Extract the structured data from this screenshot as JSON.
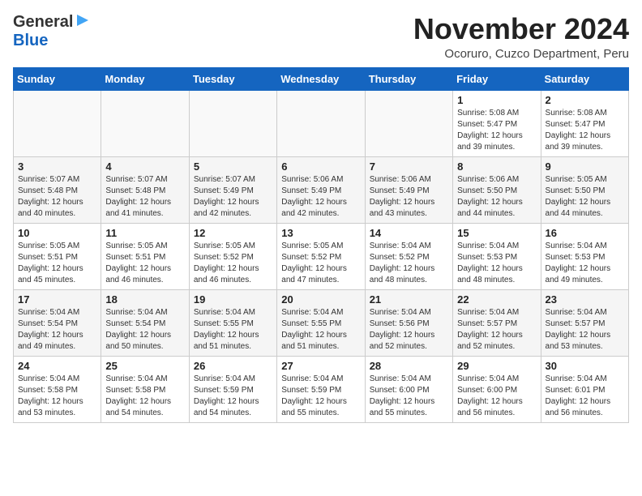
{
  "header": {
    "logo_line1": "General",
    "logo_line2": "Blue",
    "month": "November 2024",
    "location": "Ocoruro, Cuzco Department, Peru"
  },
  "weekdays": [
    "Sunday",
    "Monday",
    "Tuesday",
    "Wednesday",
    "Thursday",
    "Friday",
    "Saturday"
  ],
  "weeks": [
    [
      {
        "day": "",
        "info": ""
      },
      {
        "day": "",
        "info": ""
      },
      {
        "day": "",
        "info": ""
      },
      {
        "day": "",
        "info": ""
      },
      {
        "day": "",
        "info": ""
      },
      {
        "day": "1",
        "info": "Sunrise: 5:08 AM\nSunset: 5:47 PM\nDaylight: 12 hours\nand 39 minutes."
      },
      {
        "day": "2",
        "info": "Sunrise: 5:08 AM\nSunset: 5:47 PM\nDaylight: 12 hours\nand 39 minutes."
      }
    ],
    [
      {
        "day": "3",
        "info": "Sunrise: 5:07 AM\nSunset: 5:48 PM\nDaylight: 12 hours\nand 40 minutes."
      },
      {
        "day": "4",
        "info": "Sunrise: 5:07 AM\nSunset: 5:48 PM\nDaylight: 12 hours\nand 41 minutes."
      },
      {
        "day": "5",
        "info": "Sunrise: 5:07 AM\nSunset: 5:49 PM\nDaylight: 12 hours\nand 42 minutes."
      },
      {
        "day": "6",
        "info": "Sunrise: 5:06 AM\nSunset: 5:49 PM\nDaylight: 12 hours\nand 42 minutes."
      },
      {
        "day": "7",
        "info": "Sunrise: 5:06 AM\nSunset: 5:49 PM\nDaylight: 12 hours\nand 43 minutes."
      },
      {
        "day": "8",
        "info": "Sunrise: 5:06 AM\nSunset: 5:50 PM\nDaylight: 12 hours\nand 44 minutes."
      },
      {
        "day": "9",
        "info": "Sunrise: 5:05 AM\nSunset: 5:50 PM\nDaylight: 12 hours\nand 44 minutes."
      }
    ],
    [
      {
        "day": "10",
        "info": "Sunrise: 5:05 AM\nSunset: 5:51 PM\nDaylight: 12 hours\nand 45 minutes."
      },
      {
        "day": "11",
        "info": "Sunrise: 5:05 AM\nSunset: 5:51 PM\nDaylight: 12 hours\nand 46 minutes."
      },
      {
        "day": "12",
        "info": "Sunrise: 5:05 AM\nSunset: 5:52 PM\nDaylight: 12 hours\nand 46 minutes."
      },
      {
        "day": "13",
        "info": "Sunrise: 5:05 AM\nSunset: 5:52 PM\nDaylight: 12 hours\nand 47 minutes."
      },
      {
        "day": "14",
        "info": "Sunrise: 5:04 AM\nSunset: 5:52 PM\nDaylight: 12 hours\nand 48 minutes."
      },
      {
        "day": "15",
        "info": "Sunrise: 5:04 AM\nSunset: 5:53 PM\nDaylight: 12 hours\nand 48 minutes."
      },
      {
        "day": "16",
        "info": "Sunrise: 5:04 AM\nSunset: 5:53 PM\nDaylight: 12 hours\nand 49 minutes."
      }
    ],
    [
      {
        "day": "17",
        "info": "Sunrise: 5:04 AM\nSunset: 5:54 PM\nDaylight: 12 hours\nand 49 minutes."
      },
      {
        "day": "18",
        "info": "Sunrise: 5:04 AM\nSunset: 5:54 PM\nDaylight: 12 hours\nand 50 minutes."
      },
      {
        "day": "19",
        "info": "Sunrise: 5:04 AM\nSunset: 5:55 PM\nDaylight: 12 hours\nand 51 minutes."
      },
      {
        "day": "20",
        "info": "Sunrise: 5:04 AM\nSunset: 5:55 PM\nDaylight: 12 hours\nand 51 minutes."
      },
      {
        "day": "21",
        "info": "Sunrise: 5:04 AM\nSunset: 5:56 PM\nDaylight: 12 hours\nand 52 minutes."
      },
      {
        "day": "22",
        "info": "Sunrise: 5:04 AM\nSunset: 5:57 PM\nDaylight: 12 hours\nand 52 minutes."
      },
      {
        "day": "23",
        "info": "Sunrise: 5:04 AM\nSunset: 5:57 PM\nDaylight: 12 hours\nand 53 minutes."
      }
    ],
    [
      {
        "day": "24",
        "info": "Sunrise: 5:04 AM\nSunset: 5:58 PM\nDaylight: 12 hours\nand 53 minutes."
      },
      {
        "day": "25",
        "info": "Sunrise: 5:04 AM\nSunset: 5:58 PM\nDaylight: 12 hours\nand 54 minutes."
      },
      {
        "day": "26",
        "info": "Sunrise: 5:04 AM\nSunset: 5:59 PM\nDaylight: 12 hours\nand 54 minutes."
      },
      {
        "day": "27",
        "info": "Sunrise: 5:04 AM\nSunset: 5:59 PM\nDaylight: 12 hours\nand 55 minutes."
      },
      {
        "day": "28",
        "info": "Sunrise: 5:04 AM\nSunset: 6:00 PM\nDaylight: 12 hours\nand 55 minutes."
      },
      {
        "day": "29",
        "info": "Sunrise: 5:04 AM\nSunset: 6:00 PM\nDaylight: 12 hours\nand 56 minutes."
      },
      {
        "day": "30",
        "info": "Sunrise: 5:04 AM\nSunset: 6:01 PM\nDaylight: 12 hours\nand 56 minutes."
      }
    ]
  ]
}
